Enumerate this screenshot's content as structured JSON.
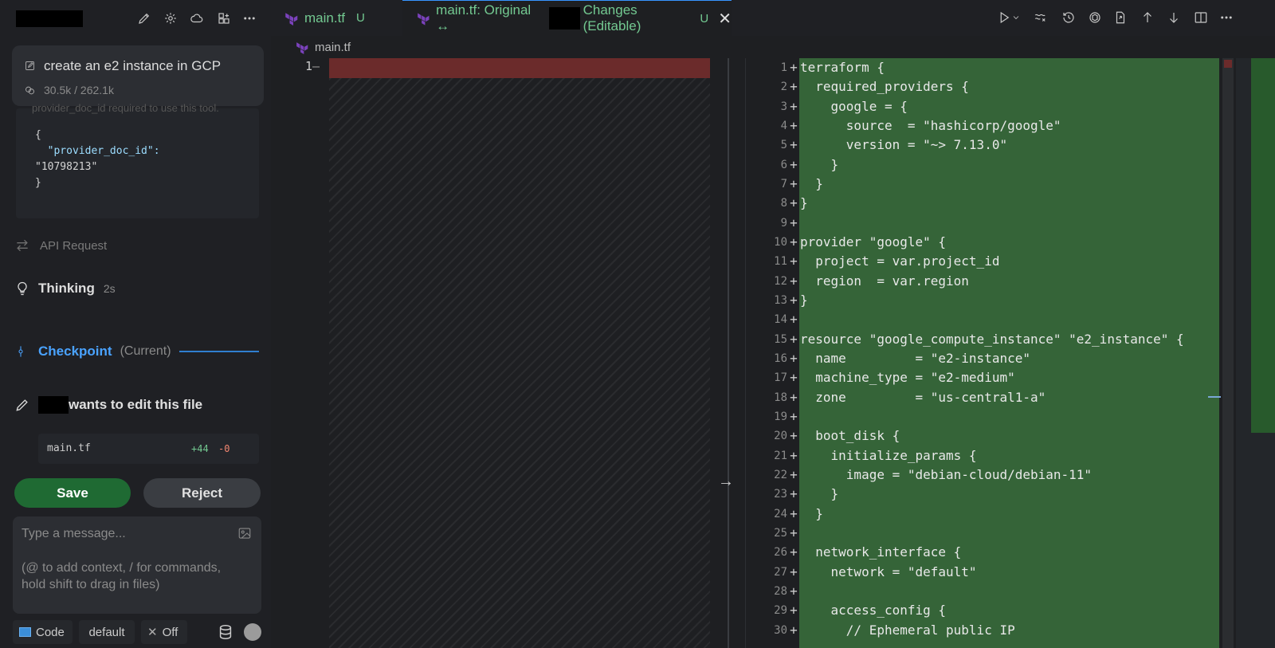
{
  "chat": {
    "task_title": "create an e2 instance in GCP",
    "tokens": "30.5k / 262.1k",
    "faded_text": "provider_doc_id required to use this tool.",
    "code_lines": [
      "{",
      "  \"provider_doc_id\":",
      "\"10798213\"",
      "}"
    ],
    "api_request_label": "API Request",
    "thinking_label": "Thinking",
    "thinking_time": "2s",
    "checkpoint_label": "Checkpoint",
    "checkpoint_status": "(Current)",
    "edit_message": "wants to edit this file",
    "edit_file_name": "main.tf",
    "edit_additions": "+44",
    "edit_deletions": "-0",
    "save_label": "Save",
    "reject_label": "Reject",
    "message_placeholder": "Type a message...",
    "message_hint": "(@ to add context, / for commands, hold shift to drag in files)",
    "mode_label": "Code",
    "profile_label": "default",
    "auto_label": "Off"
  },
  "tabs": [
    {
      "name": "main.tf",
      "status": "U"
    },
    {
      "name": "main.tf: Original ↔",
      "name_suffix": "Changes (Editable)",
      "status": "U"
    }
  ],
  "editor": {
    "breadcrumb": "main.tf",
    "left_line_number": "1",
    "left_marker": "—",
    "lines": [
      {
        "n": "1",
        "t": "terraform {"
      },
      {
        "n": "2",
        "t": "  required_providers {"
      },
      {
        "n": "3",
        "t": "    google = {"
      },
      {
        "n": "4",
        "t": "      source  = \"hashicorp/google\""
      },
      {
        "n": "5",
        "t": "      version = \"~> 7.13.0\""
      },
      {
        "n": "6",
        "t": "    }"
      },
      {
        "n": "7",
        "t": "  }"
      },
      {
        "n": "8",
        "t": "}"
      },
      {
        "n": "9",
        "t": ""
      },
      {
        "n": "10",
        "t": "provider \"google\" {"
      },
      {
        "n": "11",
        "t": "  project = var.project_id"
      },
      {
        "n": "12",
        "t": "  region  = var.region"
      },
      {
        "n": "13",
        "t": "}"
      },
      {
        "n": "14",
        "t": ""
      },
      {
        "n": "15",
        "t": "resource \"google_compute_instance\" \"e2_instance\" {"
      },
      {
        "n": "16",
        "t": "  name         = \"e2-instance\""
      },
      {
        "n": "17",
        "t": "  machine_type = \"e2-medium\""
      },
      {
        "n": "18",
        "t": "  zone         = \"us-central1-a\""
      },
      {
        "n": "19",
        "t": ""
      },
      {
        "n": "20",
        "t": "  boot_disk {"
      },
      {
        "n": "21",
        "t": "    initialize_params {"
      },
      {
        "n": "22",
        "t": "      image = \"debian-cloud/debian-11\""
      },
      {
        "n": "23",
        "t": "    }"
      },
      {
        "n": "24",
        "t": "  }"
      },
      {
        "n": "25",
        "t": ""
      },
      {
        "n": "26",
        "t": "  network_interface {"
      },
      {
        "n": "27",
        "t": "    network = \"default\""
      },
      {
        "n": "28",
        "t": ""
      },
      {
        "n": "29",
        "t": "    access_config {"
      },
      {
        "n": "30",
        "t": "      // Ephemeral public IP"
      }
    ]
  },
  "colors": {
    "accent_green": "#73c991",
    "save_button": "#1f6a33",
    "added_bg": "#356438",
    "removed_bg": "#6b2b2b",
    "link_blue": "#4aa3ff"
  }
}
